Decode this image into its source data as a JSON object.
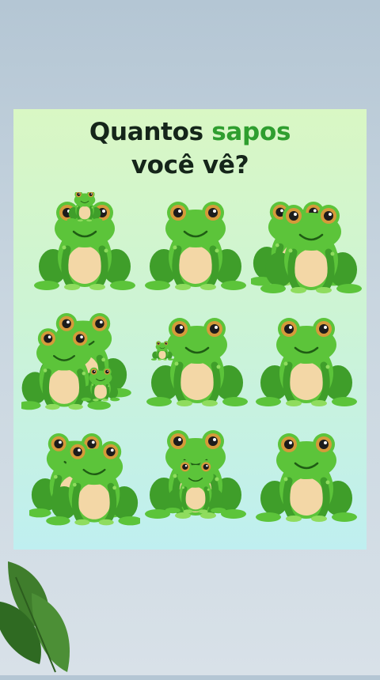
{
  "puzzle": {
    "title_part1": "Quantos",
    "title_highlight": "sapos",
    "title_line2": "você vê?"
  },
  "colors": {
    "frog_dark": "#3f9e2a",
    "frog_mid": "#5cc43a",
    "frog_light": "#8fdc5e",
    "belly": "#f3d7a6",
    "highlight_text": "#2f9e2f"
  },
  "cells": [
    {
      "id": "c1",
      "variant": "baby-on-head"
    },
    {
      "id": "c2",
      "variant": "single"
    },
    {
      "id": "c3",
      "variant": "double-offset"
    },
    {
      "id": "c4",
      "variant": "double-with-baby"
    },
    {
      "id": "c5",
      "variant": "single-with-tiny"
    },
    {
      "id": "c6",
      "variant": "single"
    },
    {
      "id": "c7",
      "variant": "double-behind"
    },
    {
      "id": "c8",
      "variant": "double-front-small"
    },
    {
      "id": "c9",
      "variant": "single"
    }
  ]
}
